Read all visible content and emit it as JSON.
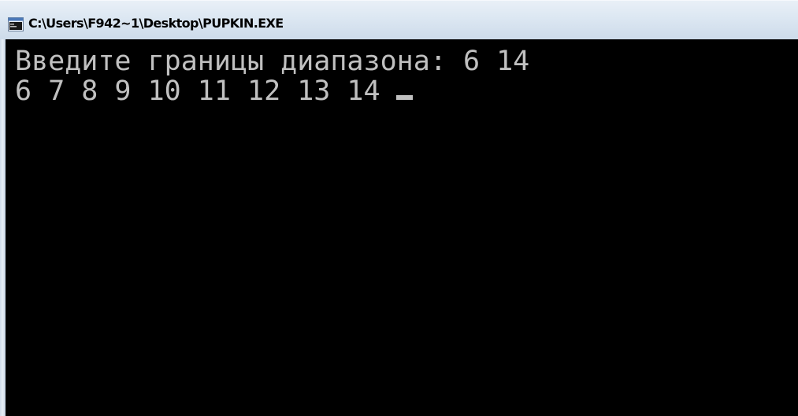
{
  "window": {
    "title": "C:\\Users\\F942~1\\Desktop\\PUPKIN.EXE",
    "icon": "console-app-icon"
  },
  "console": {
    "lines": [
      "Введите границы диапазона: 6 14",
      "6 7 8 9 10 11 12 13 14"
    ],
    "text_color": "#c0c0c0",
    "background_color": "#000000"
  }
}
